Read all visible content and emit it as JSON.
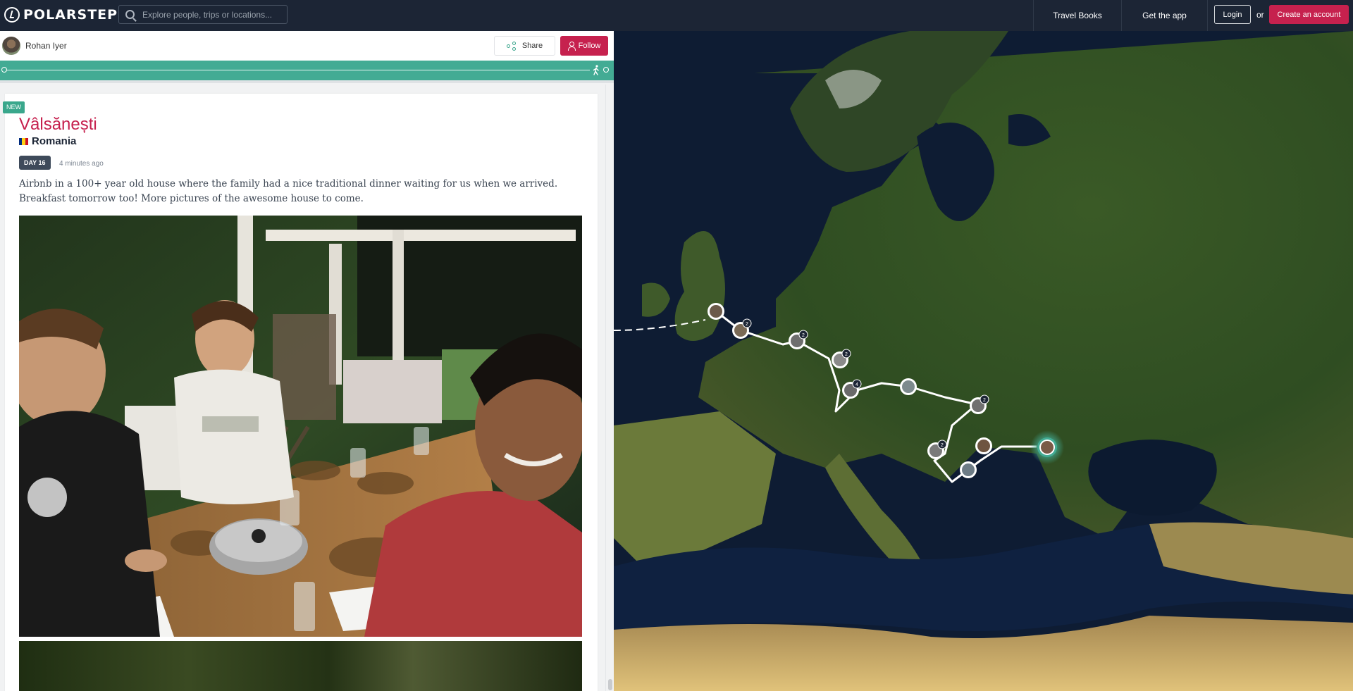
{
  "brand": {
    "name": "POLARSTEPS"
  },
  "search": {
    "placeholder": "Explore people, trips or locations..."
  },
  "nav": {
    "travel_books": "Travel Books",
    "get_app": "Get the app",
    "login": "Login",
    "or": "or",
    "create_account": "Create an account"
  },
  "profile": {
    "name": "Rohan Iyer",
    "share_label": "Share",
    "follow_label": "Follow"
  },
  "step": {
    "badge": "NEW",
    "title": "Vâlsănești",
    "country": "Romania",
    "day": "DAY 16",
    "time_ago": "4 minutes ago",
    "description": "Airbnb in a 100+ year old house where the family had a nice traditional dinner waiting for us when we arrived. Breakfast tomorrow too! More pictures of the awesome house to come."
  },
  "map": {
    "markers": [
      {
        "count": ""
      },
      {
        "count": "2"
      },
      {
        "count": "2"
      },
      {
        "count": "2"
      },
      {
        "count": "4"
      },
      {
        "count": ""
      },
      {
        "count": "2"
      },
      {
        "count": "2"
      },
      {
        "count": ""
      },
      {
        "count": ""
      },
      {
        "count": ""
      }
    ]
  },
  "colors": {
    "brand_red": "#c6214e",
    "teal": "#43ab94",
    "topbar": "#1c2535"
  },
  "icons": [
    "polarsteps-logo-icon",
    "search-icon",
    "share-icon",
    "user-icon",
    "walker-icon",
    "flag-romania-icon"
  ]
}
